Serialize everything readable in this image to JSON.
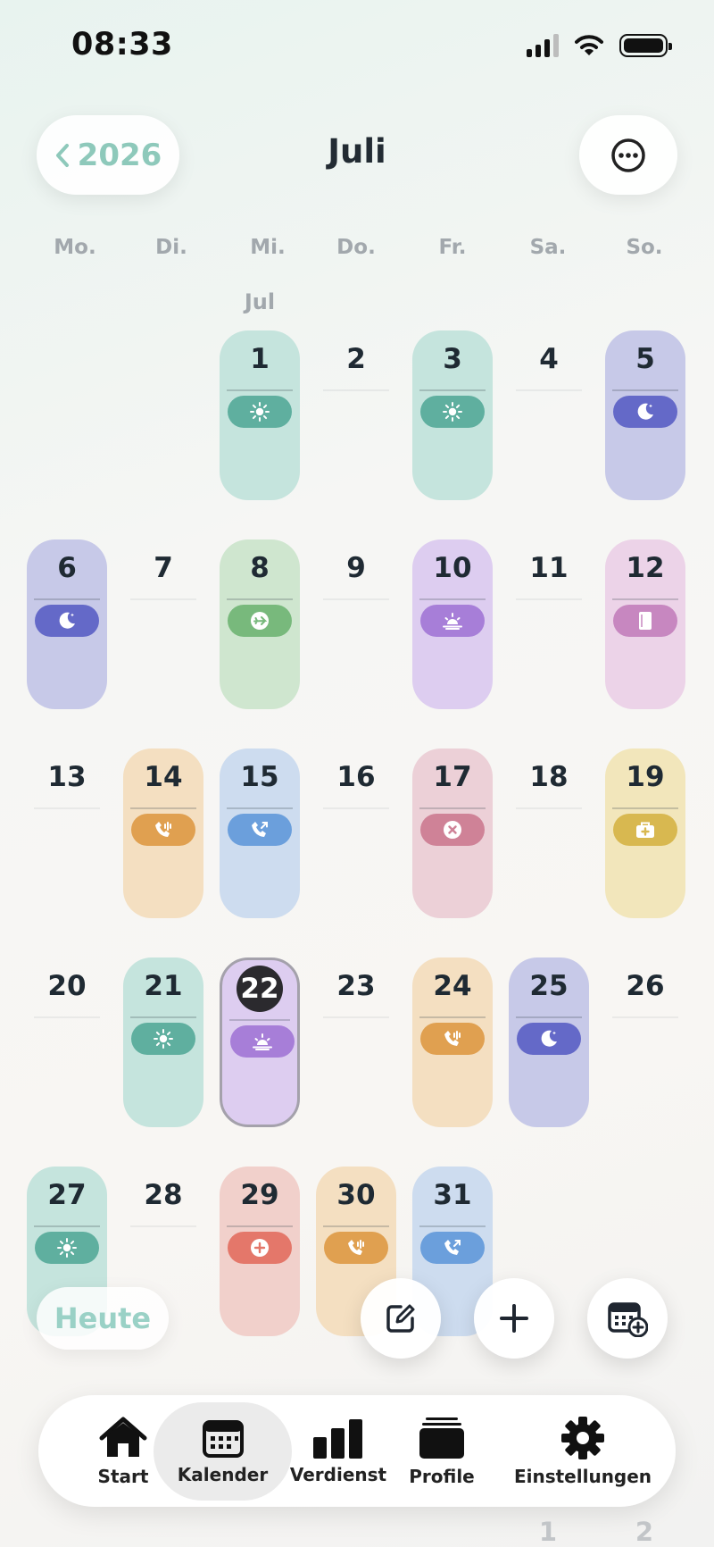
{
  "status": {
    "time": "08:33"
  },
  "header": {
    "back_label": "2026",
    "month": "Juli"
  },
  "weekdays": [
    "Mo.",
    "Di.",
    "Mi.",
    "Do.",
    "Fr.",
    "Sa.",
    "So."
  ],
  "month_label": "Jul",
  "days": [
    {
      "n": "1",
      "shift": "teal",
      "icon": "sun"
    },
    {
      "n": "2"
    },
    {
      "n": "3",
      "shift": "teal",
      "icon": "sun"
    },
    {
      "n": "4"
    },
    {
      "n": "5",
      "shift": "indigo",
      "icon": "moon"
    },
    {
      "n": "6",
      "shift": "indigo",
      "icon": "moon"
    },
    {
      "n": "7"
    },
    {
      "n": "8",
      "shift": "green",
      "icon": "plane"
    },
    {
      "n": "9"
    },
    {
      "n": "10",
      "shift": "purple",
      "icon": "sunrise"
    },
    {
      "n": "11"
    },
    {
      "n": "12",
      "shift": "pink",
      "icon": "book"
    },
    {
      "n": "13"
    },
    {
      "n": "14",
      "shift": "orange",
      "icon": "phone-wave"
    },
    {
      "n": "15",
      "shift": "blue",
      "icon": "phone-out"
    },
    {
      "n": "16"
    },
    {
      "n": "17",
      "shift": "rose",
      "icon": "x"
    },
    {
      "n": "18"
    },
    {
      "n": "19",
      "shift": "yellow",
      "icon": "medkit"
    },
    {
      "n": "20"
    },
    {
      "n": "21",
      "shift": "teal",
      "icon": "sun"
    },
    {
      "n": "22",
      "shift": "purple",
      "icon": "sunrise",
      "today": true
    },
    {
      "n": "23"
    },
    {
      "n": "24",
      "shift": "orange",
      "icon": "phone-wave"
    },
    {
      "n": "25",
      "shift": "indigo",
      "icon": "moon"
    },
    {
      "n": "26"
    },
    {
      "n": "27",
      "shift": "teal",
      "icon": "sun"
    },
    {
      "n": "28"
    },
    {
      "n": "29",
      "shift": "salmon",
      "icon": "plus"
    },
    {
      "n": "30",
      "shift": "orange",
      "icon": "phone-wave"
    },
    {
      "n": "31",
      "shift": "blue",
      "icon": "phone-out"
    }
  ],
  "shift_colors": {
    "teal": {
      "bg": "#c5e4dd",
      "pill": "#5faf9f"
    },
    "indigo": {
      "bg": "#c7c9e8",
      "pill": "#6469c8"
    },
    "green": {
      "bg": "#cfe6cf",
      "pill": "#78b97c"
    },
    "purple": {
      "bg": "#ddcdf0",
      "pill": "#a77ed8"
    },
    "pink": {
      "bg": "#ecd3e8",
      "pill": "#c787c0"
    },
    "orange": {
      "bg": "#f4dfc1",
      "pill": "#e0a050"
    },
    "blue": {
      "bg": "#cddcef",
      "pill": "#6b9fdc"
    },
    "rose": {
      "bg": "#ecd0d7",
      "pill": "#cf8297"
    },
    "yellow": {
      "bg": "#f2e6bb",
      "pill": "#d8b850"
    },
    "salmon": {
      "bg": "#f1d0cb",
      "pill": "#e4776a"
    }
  },
  "actions": {
    "today_label": "Heute"
  },
  "tabs": [
    {
      "label": "Start",
      "icon": "home-icon"
    },
    {
      "label": "Kalender",
      "icon": "calendar-icon",
      "active": true
    },
    {
      "label": "Verdienst",
      "icon": "bar-chart-icon"
    },
    {
      "label": "Profile",
      "icon": "stack-icon"
    },
    {
      "label": "Einstellungen",
      "icon": "gear-icon"
    }
  ],
  "next_month_peek": [
    "1",
    "2"
  ]
}
